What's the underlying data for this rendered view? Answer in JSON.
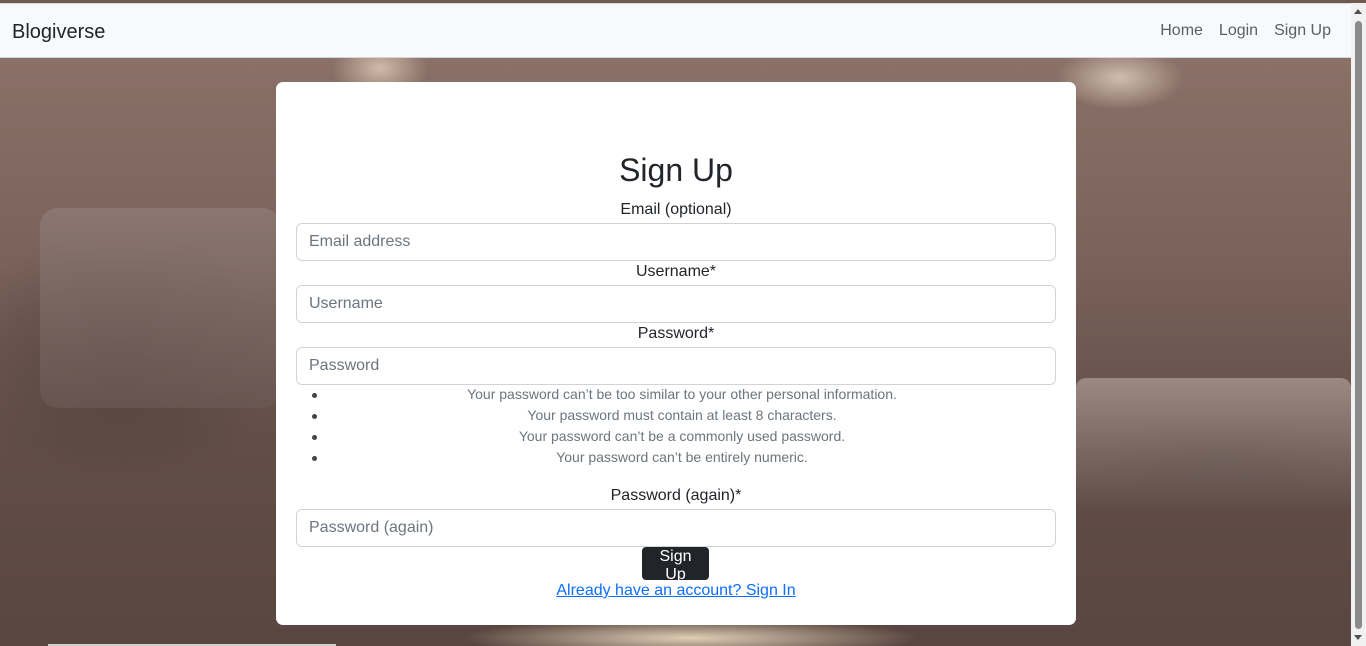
{
  "navbar": {
    "brand": "Blogiverse",
    "links": [
      {
        "label": "Home"
      },
      {
        "label": "Login"
      },
      {
        "label": "Sign Up"
      }
    ]
  },
  "form": {
    "title": "Sign Up",
    "email": {
      "label": "Email (optional)",
      "placeholder": "Email address",
      "value": ""
    },
    "username": {
      "label": "Username*",
      "placeholder": "Username",
      "value": ""
    },
    "password": {
      "label": "Password*",
      "placeholder": "Password",
      "value": ""
    },
    "password_help": [
      "Your password can’t be too similar to your other personal information.",
      "Your password must contain at least 8 characters.",
      "Your password can’t be a commonly used password.",
      "Your password can’t be entirely numeric."
    ],
    "password_again": {
      "label": "Password (again)*",
      "placeholder": "Password (again)",
      "value": ""
    },
    "submit_label": "Sign Up",
    "signin_link": "Already have an account? Sign In"
  }
}
